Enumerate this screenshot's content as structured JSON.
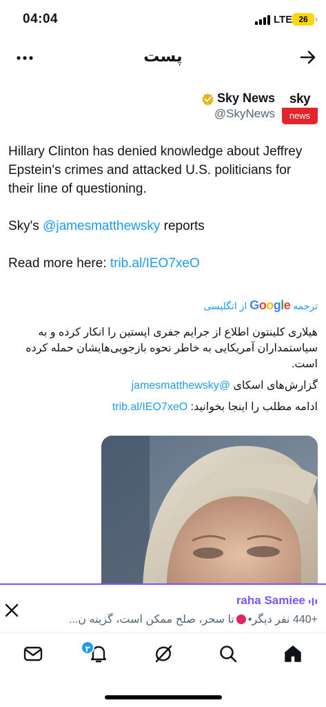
{
  "status_bar": {
    "time": "04:04",
    "network": "LTE",
    "battery": "26"
  },
  "header": {
    "title": "پست"
  },
  "author": {
    "avatar_top": "sky",
    "avatar_bottom": "news",
    "name": "Sky News",
    "handle": "@SkyNews"
  },
  "tweet": {
    "line1": "Hillary Clinton has denied knowledge about Jeffrey Epstein's crimes and attacked U.S. politicians for their line of questioning.",
    "line2_prefix": "Sky's ",
    "line2_mention": "@jamesmatthewsky",
    "line2_suffix": " reports",
    "line3_prefix": "Read more here: ",
    "line3_link": "trib.al/IEO7xeO"
  },
  "translation": {
    "label_prefix": "ترجمه",
    "google_g1": "G",
    "google_o1": "o",
    "google_o2": "o",
    "google_g2": "g",
    "google_l": "l",
    "google_e": "e",
    "label_suffix": "از انگلیسی",
    "text1": "هیلاری کلینتون اطلاع از جرایم جفری اپستین را انکار کرده و به سیاستمداران آمریکایی به خاطر نحوه بازجویی‌هایشان حمله کرده است.",
    "text2_prefix": "گزارش‌های اسکای ",
    "text2_mention": "@jamesmatthewsky",
    "text3_prefix": "ادامه مطلب را اینجا بخوانید: ",
    "text3_link": "trib.al/IEO7xeO"
  },
  "spaces": {
    "host": "raha Samiee",
    "desc_prefix": "+440 نفر دیگر•",
    "desc_suffix": "تا سحر، صلح ممکن است، گزینه ن..."
  },
  "nav": {
    "notifications_badge": "۳"
  },
  "colors": {
    "link": "#1d9bf0",
    "spaces_accent": "#7856ff",
    "sky_red": "#e3242b"
  }
}
